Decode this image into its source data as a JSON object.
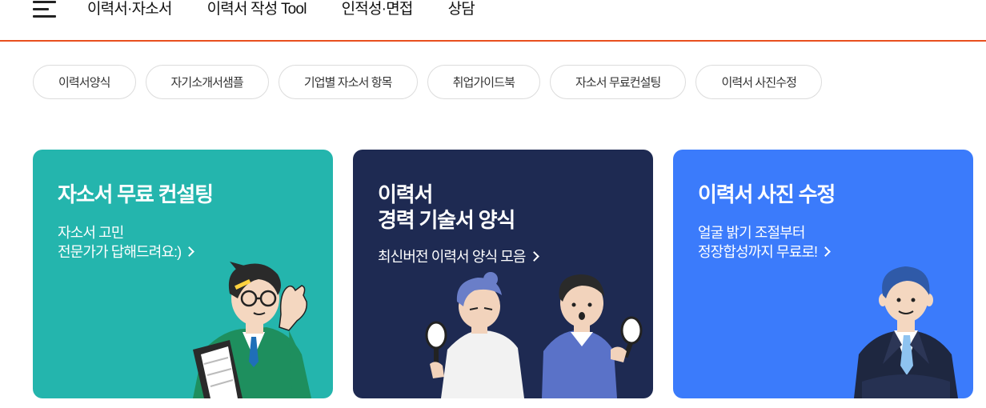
{
  "nav": {
    "items": [
      "이력서·자소서",
      "이력서 작성 Tool",
      "인적성·면접",
      "상담"
    ]
  },
  "chips": [
    "이력서양식",
    "자기소개서샘플",
    "기업별 자소서 항목",
    "취업가이드북",
    "자소서 무료컨설팅",
    "이력서 사진수정"
  ],
  "cards": [
    {
      "title": "자소서 무료 컨설팅",
      "desc": "자소서 고민\n전문가가 답해드려요:)",
      "bg": "#24b5ad"
    },
    {
      "title": "이력서\n경력 기술서 양식",
      "desc": "최신버전 이력서 양식 모음",
      "bg": "#1e2a52"
    },
    {
      "title": "이력서 사진 수정",
      "desc": "얼굴 밝기 조절부터\n정장합성까지 무료로!",
      "bg": "#3b7bfb"
    }
  ],
  "colors": {
    "accent": "#e8501e",
    "teal": "#24b5ad",
    "navy": "#1e2a52",
    "blue": "#3b7bfb"
  },
  "icons": [
    "hamburger-menu-icon",
    "chevron-right-icon"
  ]
}
